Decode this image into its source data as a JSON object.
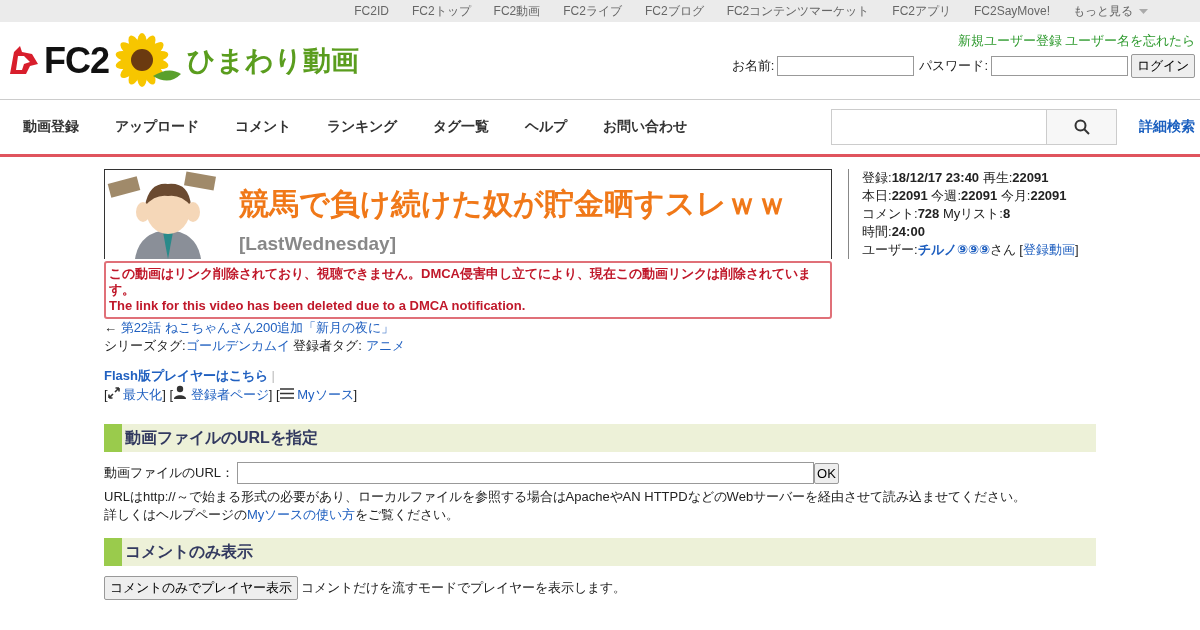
{
  "top_links": [
    "FC2ID",
    "FC2トップ",
    "FC2動画",
    "FC2ライブ",
    "FC2ブログ",
    "FC2コンテンツマーケット",
    "FC2アプリ",
    "FC2SayMove!"
  ],
  "more_link": "もっと見る",
  "logo": {
    "brand": "FC2",
    "site": "ひまわり動画"
  },
  "account_links": [
    "新規ユーザー登録",
    "ユーザー名を忘れたら"
  ],
  "login": {
    "name_label": "お名前:",
    "password_label": "パスワード:",
    "button": "ログイン"
  },
  "nav": [
    "動画登録",
    "アップロード",
    "コメント",
    "ランキング",
    "タグ一覧",
    "ヘルプ",
    "お問い合わせ"
  ],
  "search": {
    "advanced": "詳細検索"
  },
  "banner": {
    "title": "競馬で負け続けた奴が貯金晒すスレｗｗ",
    "source": "[LastWednesday]"
  },
  "stats": [
    "登録:**18/12/17 23:40** 再生:**22091**",
    "本日:**22091** 今週:**22091** 今月:**22091**",
    "コメント:**728** Myリスト:**8**",
    "時間:**24:00**"
  ],
  "user": {
    "label": "ユーザー:",
    "name": "チルノ⑨⑨⑨",
    "suffix": "さん [",
    "link": "登録動画",
    "close": "]"
  },
  "prev_arrow": "←",
  "flash_separator": "|",
  "notice": [
    "この動画はリンク削除されており、視聴できません。DMCA侵害申し立てにより、現在この動画リンクは削除されています。",
    "The link for this video has been deleted due to a DMCA notification."
  ],
  "prev_link": "第22話 ねこちゃんさん200追加「新月の夜に」",
  "series_tag_label": "シリーズタグ:",
  "series_tag": "ゴールデンカムイ",
  "uploader_tag_label": "登録者タグ:",
  "uploader_tag": "アニメ",
  "flash_link": "Flash版プレイヤーはこちら",
  "tools": [
    {
      "kind": "maximize",
      "open": "[",
      "label": "最大化",
      "close": "]"
    },
    {
      "kind": "user",
      "open": "[",
      "label": "登録者ページ",
      "close": "]"
    },
    {
      "kind": "list",
      "open": "[",
      "label": "Myソース",
      "close": "]"
    }
  ],
  "sections": [
    {
      "title": "動画ファイルのURLを指定",
      "kind": "url",
      "field_label": "動画ファイルのURL：",
      "button": "OK",
      "lines": [
        "URLはhttp://～で始まる形式の必要があり、ローカルファイルを参照する場合はApacheやAN HTTPDなどのWebサーバーを経由させて読み込ませてください。"
      ],
      "help_prefix": "詳しくはヘルプページの",
      "help_link": "Myソースの使い方",
      "help_suffix": "をご覧ください。"
    },
    {
      "title": "コメントのみ表示",
      "kind": "comment",
      "button": "コメントのみでプレイヤー表示",
      "description": "コメントだけを流すモードでプレイヤーを表示します。"
    }
  ]
}
